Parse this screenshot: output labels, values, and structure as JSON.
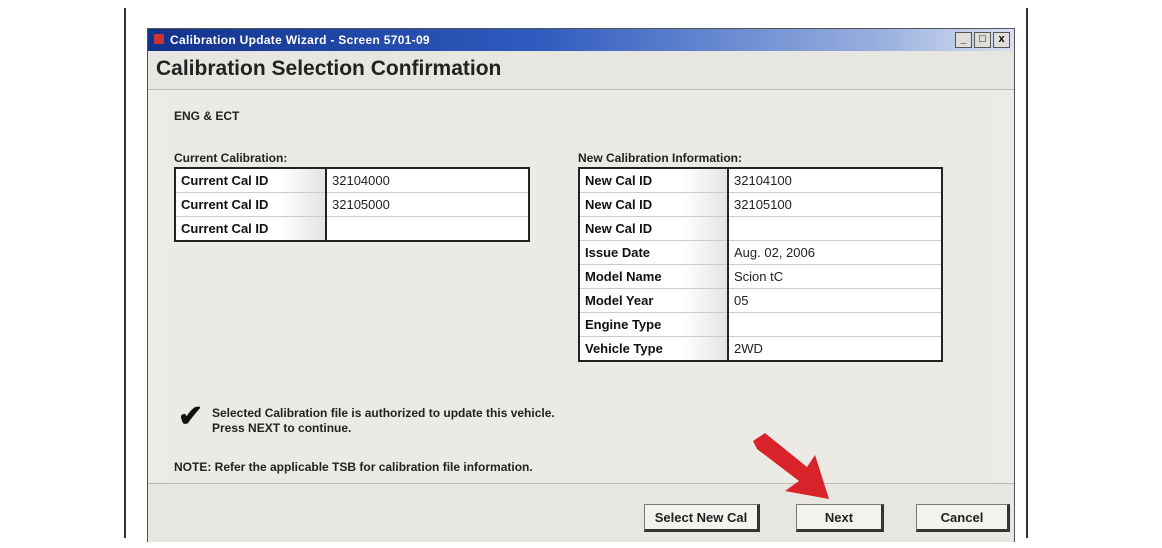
{
  "window": {
    "title": "Calibration Update Wizard - Screen 5701-09",
    "buttons": {
      "minimize": "_",
      "maximize": "□",
      "close": "x"
    }
  },
  "page_title": "Calibration Selection Confirmation",
  "module": "ENG & ECT",
  "current_calibration": {
    "label": "Current Calibration:",
    "rows": [
      {
        "key": "Current Cal ID",
        "value": "32104000"
      },
      {
        "key": "Current Cal ID",
        "value": "32105000"
      },
      {
        "key": "Current Cal ID",
        "value": ""
      }
    ]
  },
  "new_calibration": {
    "label": "New Calibration Information:",
    "rows": [
      {
        "key": "New Cal ID",
        "value": "32104100"
      },
      {
        "key": "New Cal ID",
        "value": "32105100"
      },
      {
        "key": "New Cal ID",
        "value": ""
      },
      {
        "key": "Issue Date",
        "value": "Aug. 02, 2006"
      },
      {
        "key": "Model Name",
        "value": "Scion tC"
      },
      {
        "key": "Model Year",
        "value": "05"
      },
      {
        "key": "Engine Type",
        "value": ""
      },
      {
        "key": "Vehicle Type",
        "value": "2WD"
      }
    ]
  },
  "authorization": {
    "line1": "Selected Calibration file is authorized to update this vehicle.",
    "line2": "Press NEXT to continue."
  },
  "note": "NOTE: Refer the applicable TSB for calibration file information.",
  "buttons": {
    "select_new_cal": "Select New Cal",
    "next": "Next",
    "cancel": "Cancel"
  },
  "colors": {
    "titlebar": "#11328c",
    "arrow": "#d8232a"
  },
  "icons": {
    "check": "checkmark-icon",
    "arrow": "red-pointer-arrow-icon"
  }
}
